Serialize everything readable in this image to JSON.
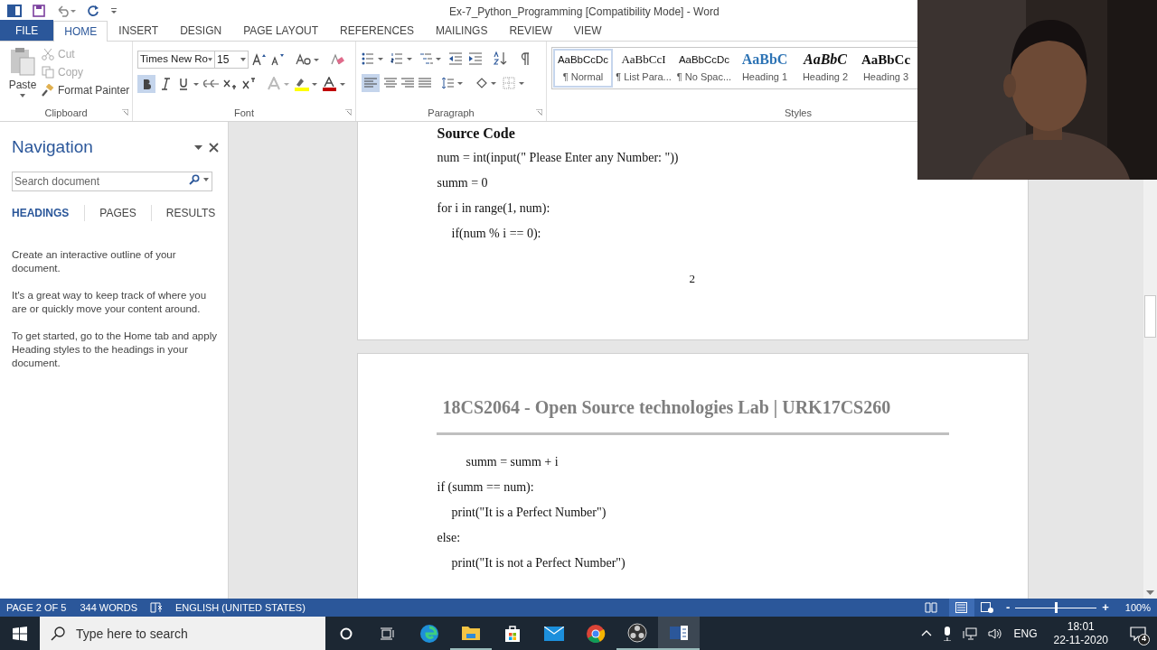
{
  "title_bar": {
    "title": "Ex-7_Python_Programming [Compatibility Mode] - Word"
  },
  "tabs": [
    {
      "label": "FILE",
      "kind": "file",
      "selected": false
    },
    {
      "label": "HOME",
      "kind": "tab",
      "selected": true
    },
    {
      "label": "INSERT",
      "kind": "tab",
      "selected": false
    },
    {
      "label": "DESIGN",
      "kind": "tab",
      "selected": false
    },
    {
      "label": "PAGE LAYOUT",
      "kind": "tab",
      "selected": false
    },
    {
      "label": "REFERENCES",
      "kind": "tab",
      "selected": false
    },
    {
      "label": "MAILINGS",
      "kind": "tab",
      "selected": false
    },
    {
      "label": "REVIEW",
      "kind": "tab",
      "selected": false
    },
    {
      "label": "VIEW",
      "kind": "tab",
      "selected": false
    }
  ],
  "ribbon": {
    "clipboard": {
      "paste": "Paste",
      "cut": "Cut",
      "copy": "Copy",
      "format_painter": "Format Painter",
      "label": "Clipboard"
    },
    "font": {
      "font_name": "Times New Ro",
      "font_size": "15",
      "bold_on": true,
      "label": "Font"
    },
    "paragraph": {
      "align_left_on": true,
      "label": "Paragraph"
    },
    "styles": {
      "label": "Styles",
      "items": [
        {
          "preview": "AaBbCcDc",
          "label": "¶ Normal",
          "kind": "normal",
          "selected": true
        },
        {
          "preview": "AaBbCcI",
          "label": "¶ List Para...",
          "kind": "serif",
          "selected": false
        },
        {
          "preview": "AaBbCcDc",
          "label": "¶ No Spac...",
          "kind": "normal",
          "selected": false
        },
        {
          "preview": "AaBbC",
          "label": "Heading 1",
          "kind": "h1",
          "selected": false
        },
        {
          "preview": "AaBbC",
          "label": "Heading 2",
          "kind": "h2",
          "selected": false
        },
        {
          "preview": "AaBbCc",
          "label": "Heading 3",
          "kind": "h3",
          "selected": false
        }
      ]
    }
  },
  "navigation": {
    "title": "Navigation",
    "search": {
      "placeholder": "Search document"
    },
    "tabs": [
      {
        "label": "HEADINGS",
        "selected": true
      },
      {
        "label": "PAGES",
        "selected": false
      },
      {
        "label": "RESULTS",
        "selected": false
      }
    ],
    "paragraphs": [
      "Create an interactive outline of your document.",
      "It's a great way to keep track of where you are or quickly move your content around.",
      "To get started, go to the Home tab and apply Heading styles to the headings in your document."
    ]
  },
  "document": {
    "page_1": {
      "heading": "Source Code",
      "lines": [
        {
          "text": "num = int(input(\" Please Enter any Number: \"))",
          "kind": "top"
        },
        {
          "text": "summ = 0",
          "kind": "top"
        },
        {
          "text": "for i in range(1, num):",
          "kind": "top"
        },
        {
          "text": "if(num % i == 0):",
          "kind": "inner"
        }
      ],
      "page_number": "2"
    },
    "page_2": {
      "header": "18CS2064 - Open Source technologies Lab | URK17CS260",
      "lines": [
        {
          "text": "summ = summ + i",
          "kind": "deep"
        },
        {
          "text": "if (summ == num):",
          "kind": "top"
        },
        {
          "text": "print(\"It is a Perfect Number\")",
          "kind": "inner"
        },
        {
          "text": "else:",
          "kind": "top"
        },
        {
          "text": "print(\"It is not a Perfect Number\")",
          "kind": "inner"
        }
      ]
    }
  },
  "status_bar": {
    "page": "PAGE 2 OF 5",
    "words": "344 WORDS",
    "language": "ENGLISH (UNITED STATES)",
    "zoom": {
      "minus": "-",
      "plus": "+",
      "level": 0.5,
      "reading": "100%"
    }
  },
  "taskbar": {
    "search": {
      "placeholder": "Type here to search"
    },
    "language": "ENG",
    "time": "18:01",
    "date": "22-11-2020",
    "notifications": "4"
  }
}
